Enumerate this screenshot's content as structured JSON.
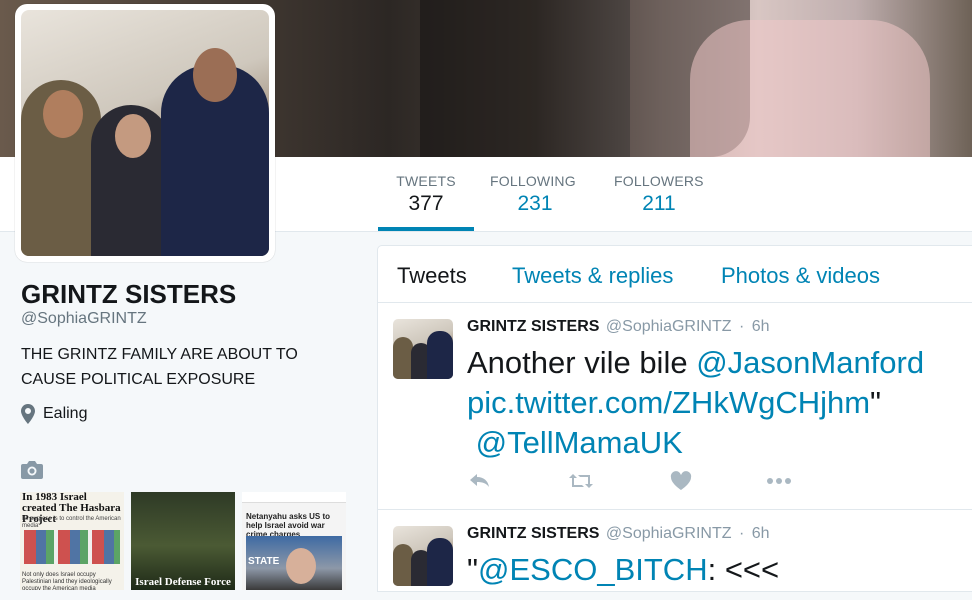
{
  "profile": {
    "name": "GRINTZ SISTERS",
    "handle": "@SophiaGRINTZ",
    "bio": "THE GRINTZ FAMILY ARE ABOUT TO CAUSE POLITICAL EXPOSURE",
    "location": "Ealing",
    "location_icon": "map-pin-icon"
  },
  "stats": {
    "tweets_label": "TWEETS",
    "tweets_value": "377",
    "following_label": "FOLLOWING",
    "following_value": "231",
    "followers_label": "FOLLOWERS",
    "followers_value": "211"
  },
  "media": {
    "icon": "camera-icon",
    "thumb1_title": "In 1983 Israel created The Hasbara Project",
    "thumb1_sub": "Its purpose is to control the American media",
    "thumb1_foot": "Not only does Israel occupy Palestinian land they ideologically occupy the American media",
    "thumb2_caption": "Israel Defense Force",
    "thumb3_title": "Netanyahu asks US to help Israel avoid war crime charges",
    "thumb3_state": "STATE"
  },
  "timeline": {
    "tabs": [
      {
        "label": "Tweets"
      },
      {
        "label": "Tweets & replies"
      },
      {
        "label": "Photos & videos"
      }
    ],
    "tweets": [
      {
        "name": "GRINTZ SISTERS",
        "handle": "@SophiaGRINTZ",
        "dot": "·",
        "time": "6h",
        "text_plain1": "Another vile bile ",
        "mention1": "@JasonManford",
        "link": "pic.twitter.com/ZHkWgCHjhm",
        "text_plain2": "\"",
        "mention2": "@TellMamaUK"
      },
      {
        "name": "GRINTZ SISTERS",
        "handle": "@SophiaGRINTZ",
        "dot": "·",
        "time": "6h",
        "text_plain1": "\"",
        "mention1": "@ESCO_BITCH",
        "text_plain2": ": <<<"
      }
    ],
    "actions": [
      "reply-icon",
      "retweet-icon",
      "like-icon",
      "more-icon"
    ]
  },
  "colors": {
    "link": "#0084b4",
    "text": "#14171a",
    "muted": "#66757f",
    "background": "#f5f8fa"
  }
}
